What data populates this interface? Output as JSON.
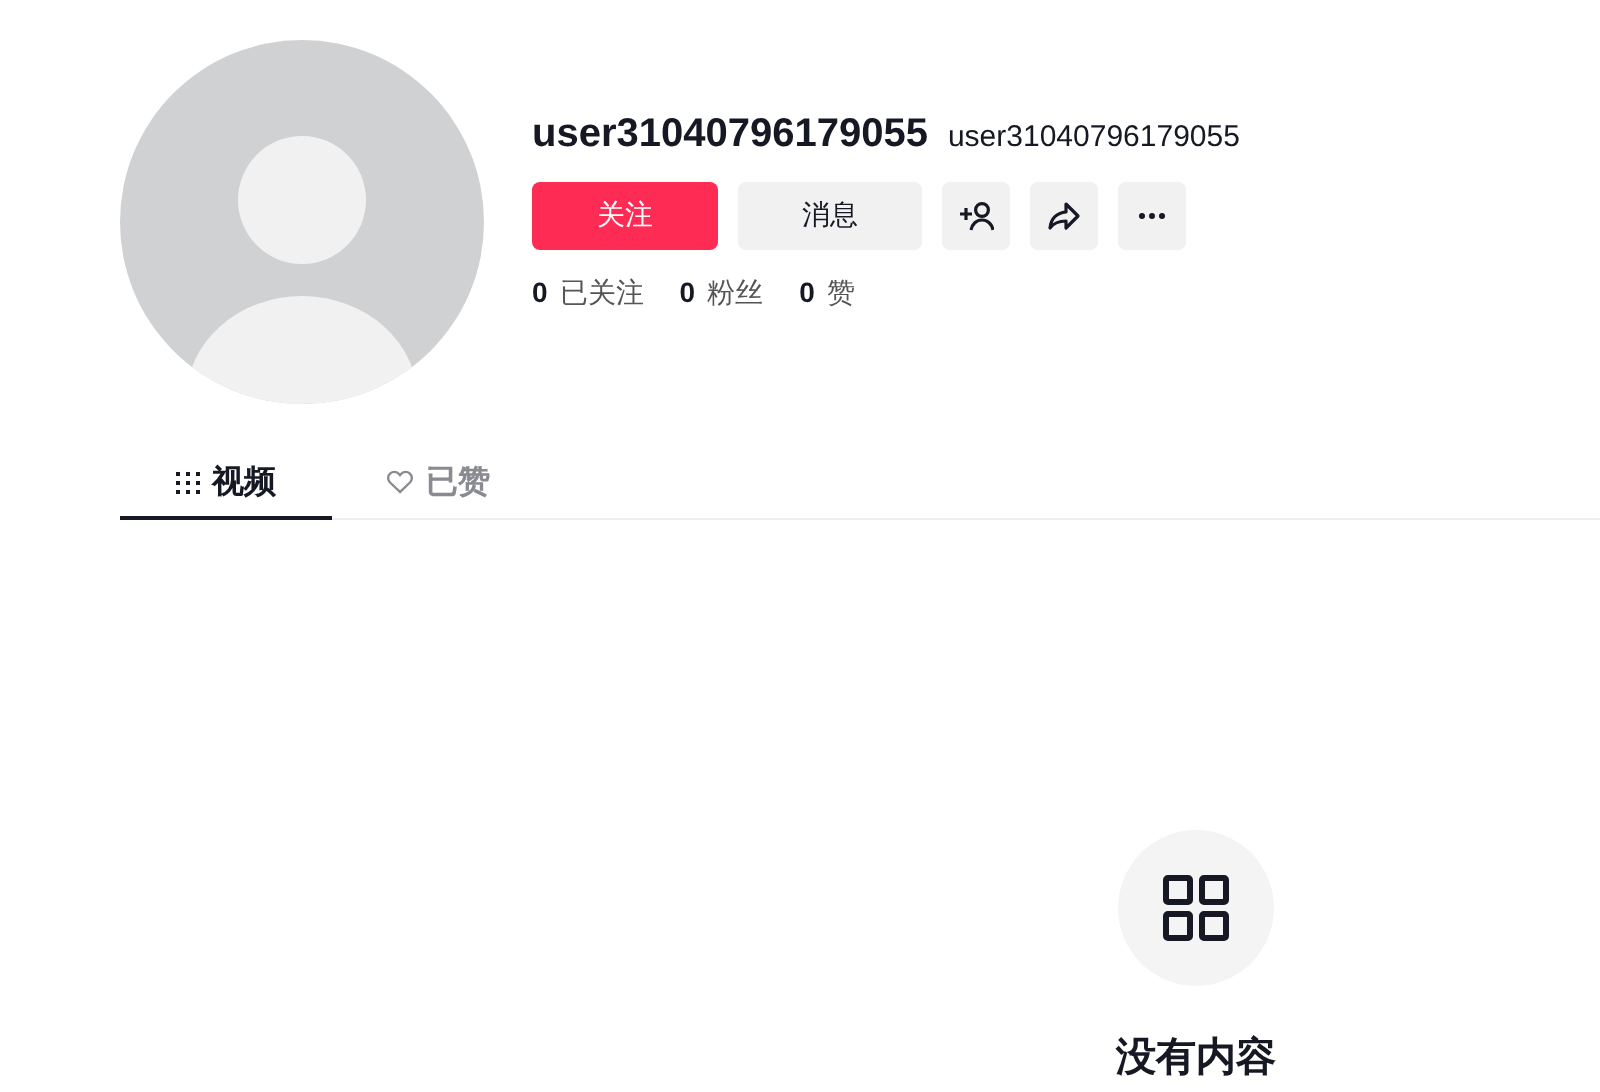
{
  "profile": {
    "display_name": "user31040796179055",
    "handle": "user31040796179055"
  },
  "actions": {
    "follow": "关注",
    "message": "消息"
  },
  "stats": [
    {
      "count": "0",
      "label": "已关注"
    },
    {
      "count": "0",
      "label": "粉丝"
    },
    {
      "count": "0",
      "label": "赞"
    }
  ],
  "tabs": [
    {
      "label": "视频",
      "selected": true
    },
    {
      "label": "已赞",
      "selected": false
    }
  ],
  "empty_state": {
    "text": "没有内容"
  }
}
